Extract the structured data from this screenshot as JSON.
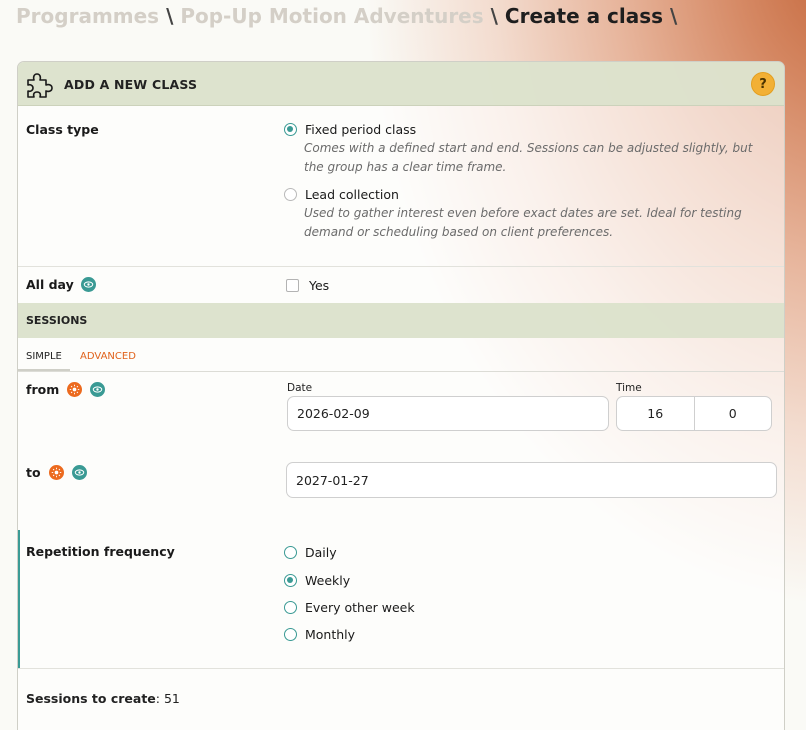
{
  "breadcrumb": {
    "items": [
      "Programmes",
      "Pop-Up Motion Adventures"
    ],
    "current": "Create a class",
    "separator": "\\"
  },
  "panel": {
    "title": "ADD A NEW CLASS",
    "help_symbol": "?"
  },
  "class_type": {
    "label": "Class type",
    "options": [
      {
        "label": "Fixed period class",
        "description_lines": [
          "Comes with a defined start and end. Sessions can be adjusted slightly, but",
          "the group has a clear time frame."
        ],
        "checked": true
      },
      {
        "label": "Lead collection",
        "description_lines": [
          "Used to gather interest even before exact dates are set. Ideal for testing",
          "demand or scheduling based on client preferences."
        ],
        "checked": false
      }
    ]
  },
  "all_day": {
    "label": "All day",
    "checkbox_label": "Yes",
    "checked": false
  },
  "sessions": {
    "header": "SESSIONS",
    "tabs": {
      "simple": "SIMPLE",
      "advanced": "ADVANCED",
      "active": "simple"
    }
  },
  "from": {
    "label": "from",
    "date_label": "Date",
    "date_value": "2026-02-09",
    "time_label": "Time",
    "hour_value": "16",
    "minute_value": "0"
  },
  "to": {
    "label": "to",
    "date_value": "2027-01-27"
  },
  "repetition": {
    "label": "Repetition frequency",
    "options": [
      {
        "label": "Daily",
        "checked": false
      },
      {
        "label": "Weekly",
        "checked": true
      },
      {
        "label": "Every other week",
        "checked": false
      },
      {
        "label": "Monthly",
        "checked": false
      }
    ]
  },
  "summary": {
    "label": "Sessions to create",
    "count": "51"
  },
  "colors": {
    "teal": "#3a9a94",
    "orange": "#ec6a1e",
    "header_green": "#dbe1cb",
    "help_yellow": "#f2b035"
  }
}
